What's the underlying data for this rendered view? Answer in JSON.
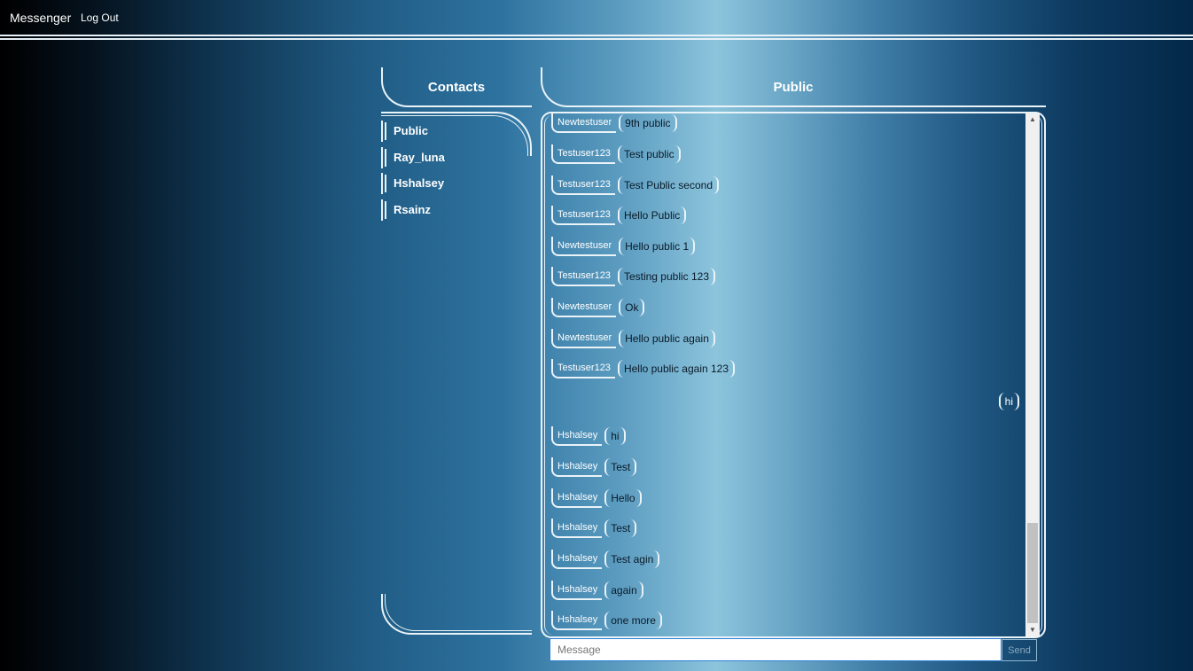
{
  "navbar": {
    "brand": "Messenger",
    "logout": "Log Out"
  },
  "contacts": {
    "title": "Contacts",
    "items": [
      "Public",
      "Ray_luna",
      "Hshalsey",
      "Rsainz"
    ]
  },
  "chat": {
    "title": "Public",
    "messages": [
      {
        "sender": "Newtestuser",
        "text": "9th public"
      },
      {
        "sender": "Testuser123",
        "text": "Test public"
      },
      {
        "sender": "Testuser123",
        "text": "Test Public second"
      },
      {
        "sender": "Testuser123",
        "text": "Hello Public"
      },
      {
        "sender": "Newtestuser",
        "text": "Hello public 1"
      },
      {
        "sender": "Testuser123",
        "text": "Testing public 123"
      },
      {
        "sender": "Newtestuser",
        "text": "Ok"
      },
      {
        "sender": "Newtestuser",
        "text": "Hello public again"
      },
      {
        "sender": "Testuser123",
        "text": "Hello public again 123"
      },
      {
        "sender": "Hshalsey",
        "text": "hi"
      },
      {
        "sender": "Hshalsey",
        "text": "Test"
      },
      {
        "sender": "Hshalsey",
        "text": "Hello"
      },
      {
        "sender": "Hshalsey",
        "text": "Test"
      },
      {
        "sender": "Hshalsey",
        "text": "Test agin"
      },
      {
        "sender": "Hshalsey",
        "text": "again"
      },
      {
        "sender": "Hshalsey",
        "text": "one more"
      }
    ],
    "self_message": "hi"
  },
  "composer": {
    "placeholder": "Message",
    "send_label": "Send"
  }
}
